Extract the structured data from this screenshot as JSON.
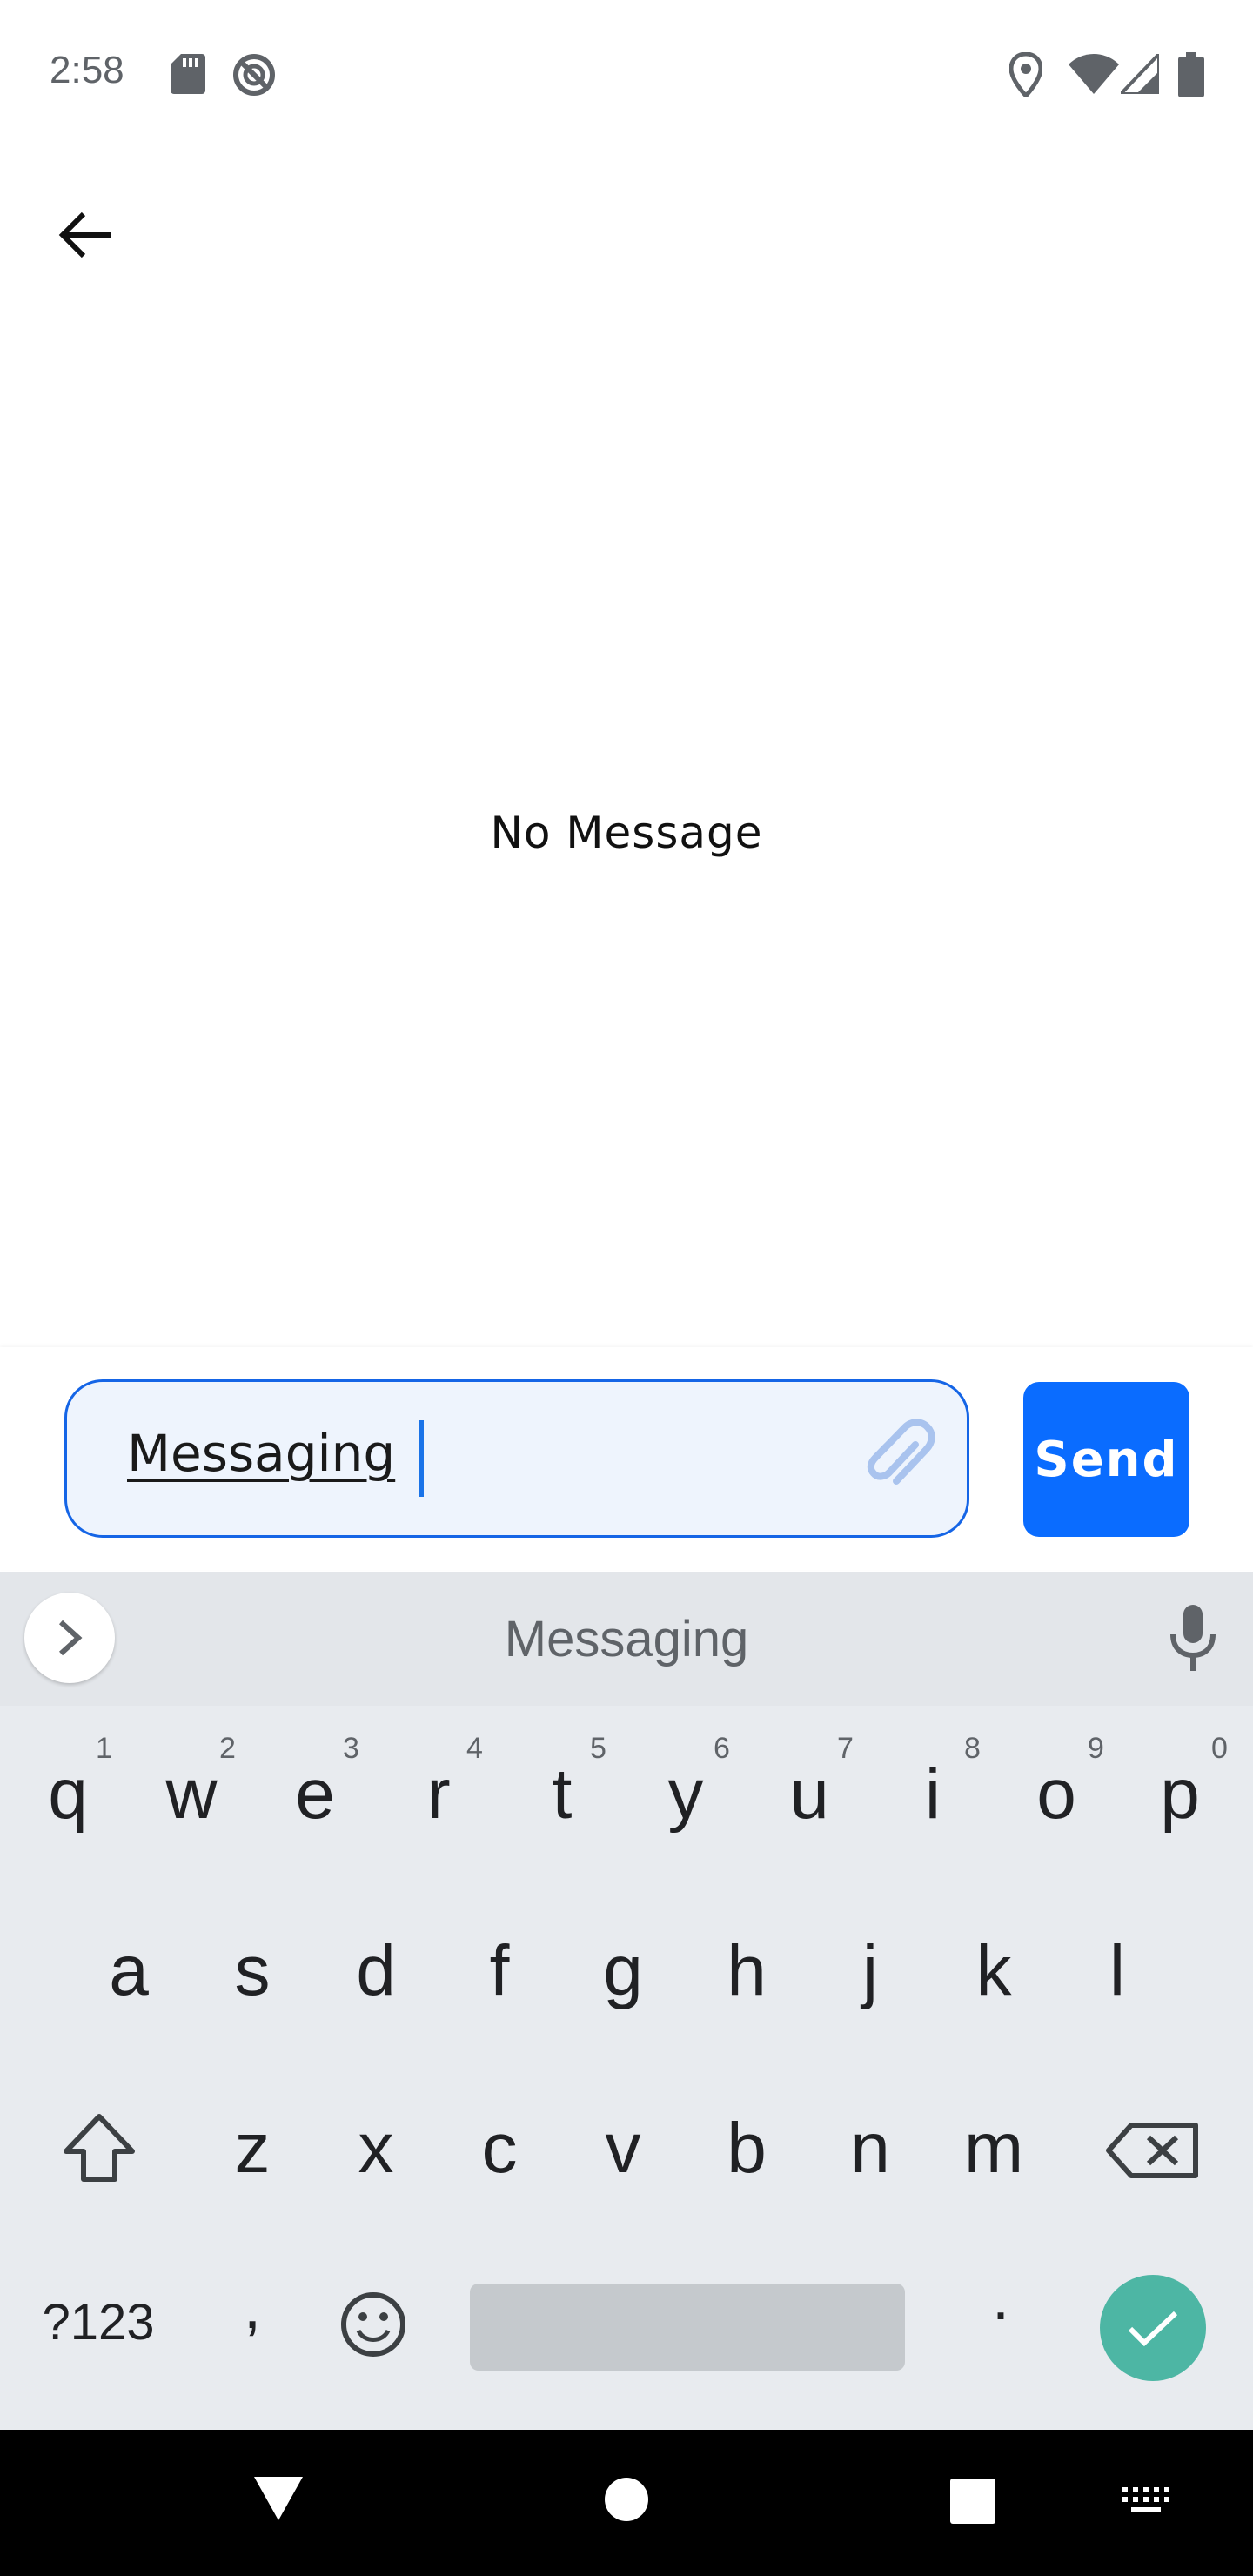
{
  "status_bar": {
    "time": "2:58",
    "icons": [
      "sd-card-icon",
      "no-disturb-icon",
      "location-icon",
      "wifi-icon",
      "signal-icon",
      "battery-icon"
    ]
  },
  "app_bar": {
    "back_icon": "arrow-back-icon"
  },
  "main": {
    "empty_text": "No Message"
  },
  "composer": {
    "input_value": "Messaging",
    "attach_icon": "paperclip-icon",
    "send_label": "Send",
    "accent": "#0a6cff"
  },
  "keyboard": {
    "suggestion": "Messaging",
    "row1": [
      {
        "key": "q",
        "hint": "1"
      },
      {
        "key": "w",
        "hint": "2"
      },
      {
        "key": "e",
        "hint": "3"
      },
      {
        "key": "r",
        "hint": "4"
      },
      {
        "key": "t",
        "hint": "5"
      },
      {
        "key": "y",
        "hint": "6"
      },
      {
        "key": "u",
        "hint": "7"
      },
      {
        "key": "i",
        "hint": "8"
      },
      {
        "key": "o",
        "hint": "9"
      },
      {
        "key": "p",
        "hint": "0"
      }
    ],
    "row2": [
      "a",
      "s",
      "d",
      "f",
      "g",
      "h",
      "j",
      "k",
      "l"
    ],
    "row3": [
      "z",
      "x",
      "c",
      "v",
      "b",
      "n",
      "m"
    ],
    "symbols_label": "?123",
    "comma": ",",
    "period": ".",
    "enter_color": "#4db6a4"
  },
  "nav_bar": {
    "icons": [
      "back-triangle-icon",
      "home-circle-icon",
      "recents-square-icon",
      "keyboard-switch-icon"
    ]
  }
}
